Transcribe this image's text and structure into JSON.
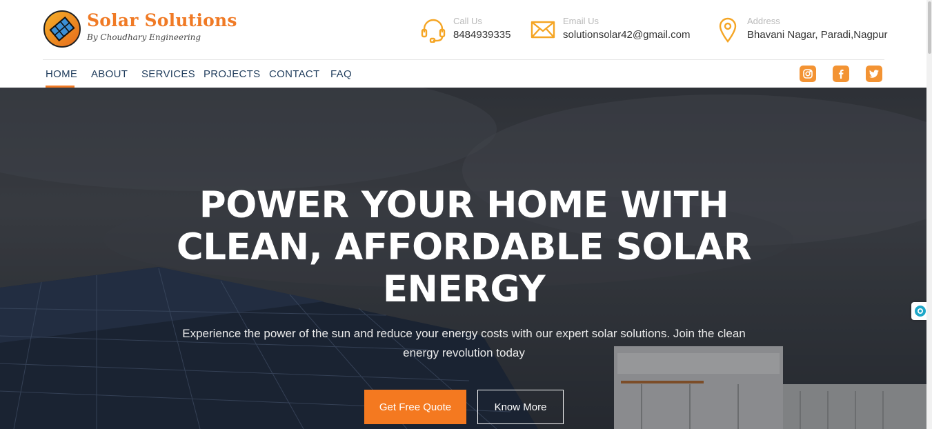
{
  "brand": {
    "name": "Solar Solutions",
    "tagline": "By Choudhary Engineering"
  },
  "contacts": {
    "call": {
      "label": "Call Us",
      "value": "8484939335",
      "icon": "headset-icon"
    },
    "email": {
      "label": "Email Us",
      "value": "solutionsolar42@gmail.com",
      "icon": "envelope-icon"
    },
    "address": {
      "label": "Address",
      "value": "Bhavani Nagar, Paradi,Nagpur",
      "icon": "map-pin-icon"
    }
  },
  "nav": {
    "items": [
      {
        "label": "HOME",
        "active": true
      },
      {
        "label": "ABOUT"
      },
      {
        "label": "SERVICES"
      },
      {
        "label": "PROJECTS"
      },
      {
        "label": "CONTACT"
      },
      {
        "label": "FAQ"
      }
    ]
  },
  "social": [
    "instagram-icon",
    "facebook-icon",
    "twitter-icon"
  ],
  "hero": {
    "title": "POWER YOUR HOME WITH CLEAN, AFFORDABLE SOLAR ENERGY",
    "subtitle": "Experience the power of the sun and reduce your energy costs with our expert solar solutions. Join the clean energy revolution today",
    "primary_button": "Get Free Quote",
    "secondary_button": "Know More"
  },
  "colors": {
    "accent": "#f07a25",
    "nav_text": "#1f3c5c",
    "social_bg": "#f39333"
  }
}
